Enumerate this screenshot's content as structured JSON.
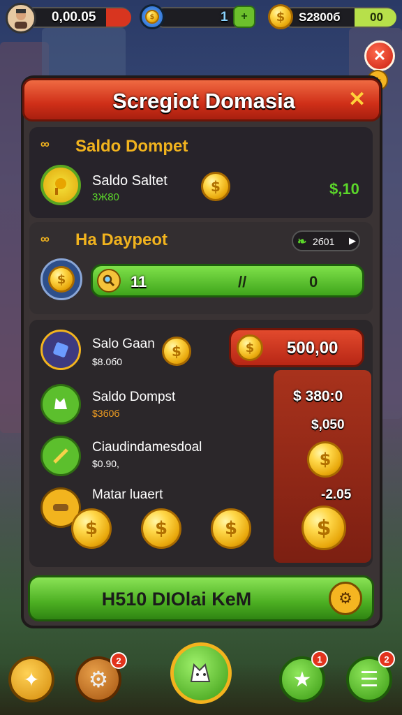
{
  "top_bar": {
    "player_value": "0,00.05",
    "energy_value": "1",
    "coin_value": "S2800б",
    "gem_value": "00"
  },
  "dialog": {
    "title": "Scregiot Domasia",
    "section1": {
      "heading": "Saldo Dompet",
      "item_name": "Saldo Saltet",
      "item_sub": "3Ж80",
      "amount": "$,10"
    },
    "section2": {
      "heading": "Ha Daypeot",
      "chip": "2б01",
      "bar_left": "11",
      "bar_mid": "//",
      "bar_right": "0"
    },
    "rows": [
      {
        "name": "Salo Gaan",
        "sub": "$8.0б0"
      },
      {
        "name": "Saldo Dompst",
        "sub": "$3б0б"
      },
      {
        "name": "Ciaudindamesdoal",
        "sub": "$0.90,"
      },
      {
        "name": "Matar luaert",
        "sub": ""
      }
    ],
    "red_panel": {
      "top_value": "500,00",
      "v1": "$ 380:0",
      "v2": "$,050",
      "v3": "-2.05"
    },
    "cta_label": "H510 DIOlai KeM"
  },
  "bottom_nav": {
    "settings_badge": "2",
    "star_badge": "1",
    "menu_badge": "2"
  },
  "colors": {
    "title_red": "#d63a1f",
    "accent_green": "#5bc12a",
    "gold": "#f5c33b",
    "panel_dark": "#2e2a2c"
  }
}
